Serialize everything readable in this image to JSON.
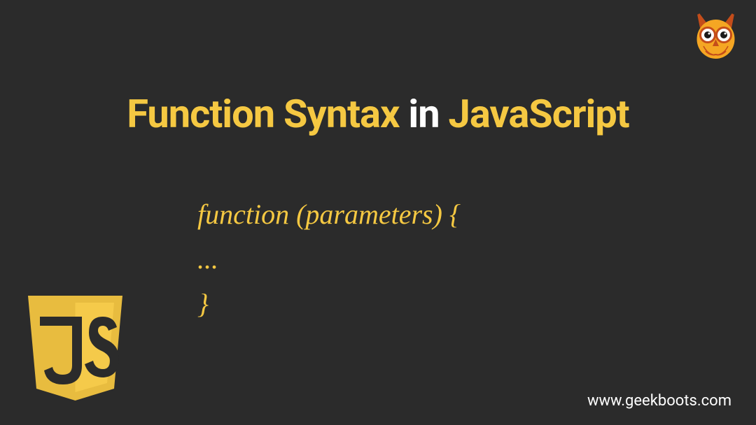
{
  "title": {
    "part1": "Function Syntax",
    "part2": " in ",
    "part3": "JavaScript"
  },
  "code": {
    "line1": "function (parameters) {",
    "line2": "...",
    "line3": "}"
  },
  "footer": {
    "url": "www.geekboots.com"
  },
  "logos": {
    "owl": "owl-logo",
    "js": "js-logo"
  }
}
